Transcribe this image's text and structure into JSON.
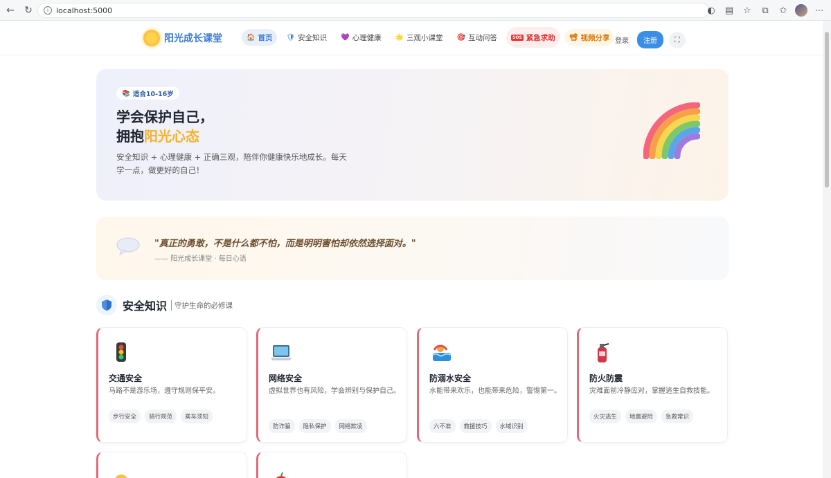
{
  "browser": {
    "url": "localhost:5000"
  },
  "header": {
    "logo_text": "阳光成长课堂",
    "menu": [
      {
        "icon": "🏠",
        "label": "首页"
      },
      {
        "icon": "🛡",
        "label": "安全知识"
      },
      {
        "icon": "💜",
        "label": "心理健康"
      },
      {
        "icon": "🌟",
        "label": "三观小课堂"
      },
      {
        "icon": "🎯",
        "label": "互动问答"
      },
      {
        "icon": "SOS",
        "label": "紧急求助"
      },
      {
        "icon": "📽",
        "label": "视频分享"
      }
    ],
    "login": "登录",
    "register": "注册",
    "fullscreen_icon": "⛶"
  },
  "hero": {
    "badge": "适合10-16岁",
    "title_line1": "学会保护自己，",
    "title_line2_prefix": "拥抱",
    "title_line2_highlight": "阳光心态",
    "desc": "安全知识 + 心理健康 + 正确三观，陪伴你健康快乐地成长。每天学一点，做更好的自己！"
  },
  "quote": {
    "text": "\"真正的勇敢，不是什么都不怕，而是明明害怕却依然选择面对。\"",
    "source": "—— 阳光成长课堂 · 每日心语"
  },
  "section": {
    "title": "安全知识",
    "subtitle": "守护生命的必修课"
  },
  "cards": [
    {
      "icon": "traffic-light-icon",
      "title": "交通安全",
      "desc": "马路不是游乐场，遵守规则保平安。",
      "tags": [
        "步行安全",
        "骑行规范",
        "乘车须知"
      ]
    },
    {
      "icon": "laptop-icon",
      "title": "网络安全",
      "desc": "虚拟世界也有风险，学会辨别与保护自己。",
      "tags": [
        "防诈骗",
        "隐私保护",
        "网络欺凌"
      ]
    },
    {
      "icon": "water-icon",
      "title": "防溺水安全",
      "desc": "水能带来欢乐，也能带来危险，警惕第一。",
      "tags": [
        "六不准",
        "救援技巧",
        "水域识别"
      ]
    },
    {
      "icon": "fire-extinguisher-icon",
      "title": "防火防震",
      "desc": "灾难面前冷静应对，掌握逃生自救技能。",
      "tags": [
        "火灾逃生",
        "地震避险",
        "急救常识"
      ]
    }
  ]
}
